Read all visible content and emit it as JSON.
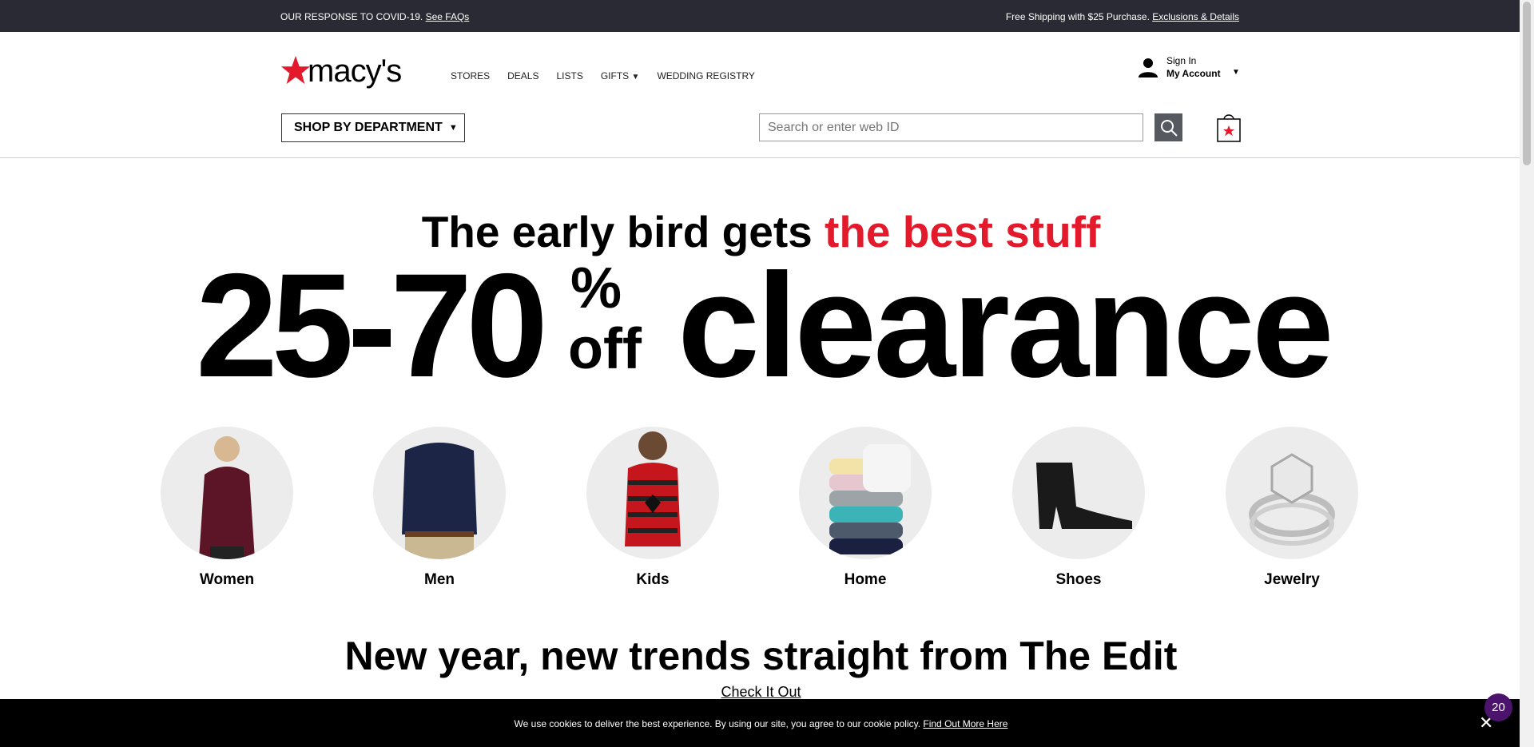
{
  "topbar": {
    "covid_text": "OUR RESPONSE TO COVID-19.",
    "covid_link": "See FAQs",
    "shipping_text": "Free Shipping with $25 Purchase.",
    "shipping_link": "Exclusions & Details"
  },
  "header": {
    "logo_text": "macy's",
    "nav": [
      "STORES",
      "DEALS",
      "LISTS",
      "GIFTS",
      "WEDDING REGISTRY"
    ],
    "account": {
      "signin": "Sign In",
      "my_account": "My Account"
    },
    "shop_by_department": "SHOP BY DEPARTMENT",
    "search": {
      "placeholder": "Search or enter web ID"
    }
  },
  "hero": {
    "headline_black": "The early bird gets ",
    "headline_red": "the best stuff",
    "discount": "25-70",
    "percent": "%",
    "off": "off",
    "word": "clearance"
  },
  "categories": [
    "Women",
    "Men",
    "Kids",
    "Home",
    "Shoes",
    "Jewelry"
  ],
  "edit": {
    "title": "New year, new trends straight from The Edit",
    "link": "Check It Out"
  },
  "cookie": {
    "message": "We use cookies to deliver the best experience. By using our site, you agree to our cookie policy.",
    "link": "Find Out More Here"
  },
  "chat_badge": "20",
  "colors": {
    "brand_red": "#e21a2c",
    "topbar_bg": "#292a33",
    "badge": "#4b136c"
  }
}
